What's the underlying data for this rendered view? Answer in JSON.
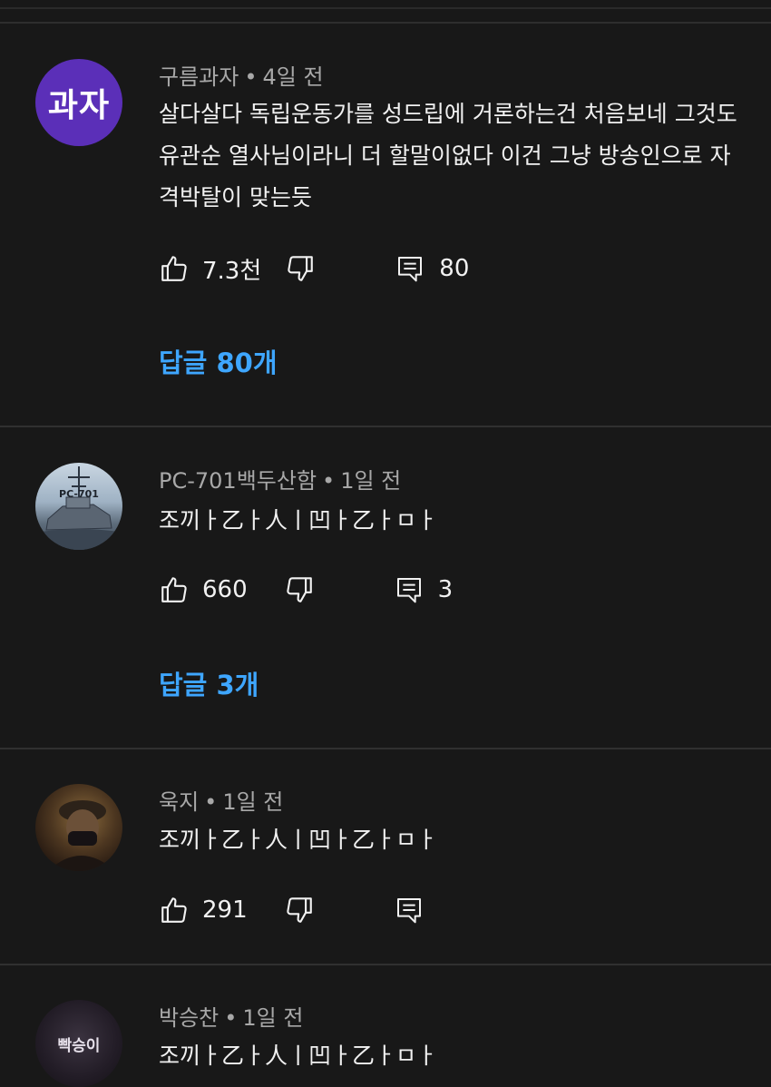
{
  "comments": [
    {
      "avatar_text": "과자",
      "author": "구름과자",
      "separator": "•",
      "time": "4일 전",
      "lines": [
        "살다살다 독립운동가를 성드립에 거론하는건 처음보네 그것도",
        "유관순 열사님이라니 더 할말이없다 이건 그냥 방송인으로 자",
        "격박탈이 맞는듯"
      ],
      "likes": "7.3천",
      "reply_count": "80",
      "replies_label": "답글 80개"
    },
    {
      "avatar_text": "PC-701",
      "author": "PC-701백두산함",
      "separator": "•",
      "time": "1일 전",
      "lines": [
        "조끼ㅏ乙ㅏ人ㅣ凹ㅏ乙ㅏㅁㅏ"
      ],
      "likes": "660",
      "reply_count": "3",
      "replies_label": "답글 3개"
    },
    {
      "author": "욱지",
      "separator": "•",
      "time": "1일 전",
      "lines": [
        "조끼ㅏ乙ㅏ人ㅣ凹ㅏ乙ㅏㅁㅏ"
      ],
      "likes": "291",
      "reply_count": ""
    },
    {
      "avatar_text": "빡승이",
      "author": "박승찬",
      "separator": "•",
      "time": "1일 전",
      "lines": [
        "조끼ㅏ乙ㅏ人ㅣ凹ㅏ乙ㅏㅁㅏ"
      ]
    }
  ],
  "icons": {
    "like": "thumbs-up-icon",
    "dislike": "thumbs-down-icon",
    "reply": "comment-icon"
  },
  "colors": {
    "background": "#181818",
    "reply_link": "#3ea6ff",
    "avatar_purple": "#5b2fb8"
  }
}
